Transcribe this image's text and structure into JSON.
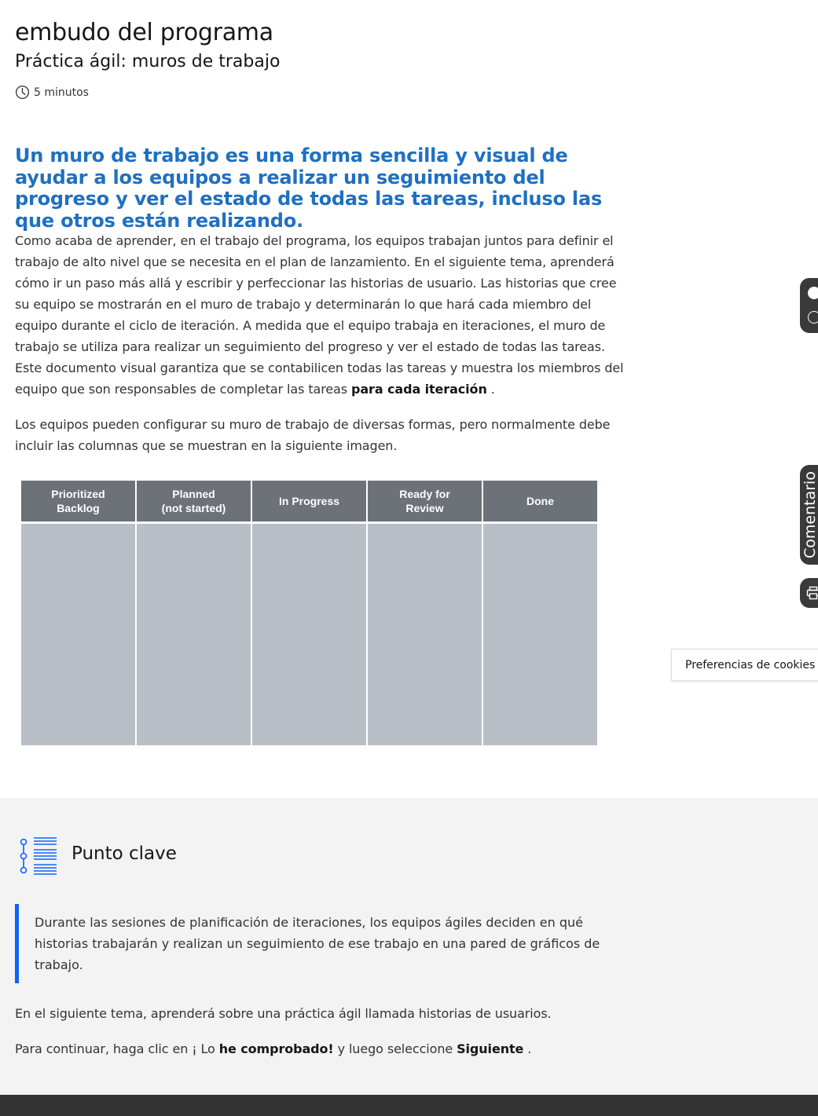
{
  "header": {
    "course_title": "embudo del programa",
    "lesson_title": "Práctica ágil: muros de trabajo",
    "duration": "5 minutos"
  },
  "lead": "Un muro de trabajo es una forma sencilla y visual de ayudar a los equipos a realizar un seguimiento del progreso y ver el estado de todas las tareas, incluso las que otros están realizando.",
  "body": {
    "p1_text": "Como acaba de aprender, en el trabajo del programa, los equipos trabajan juntos para definir el trabajo de alto nivel que se necesita en el plan de lanzamiento. En el siguiente tema, aprenderá cómo ir un paso más allá y escribir y perfeccionar las historias de usuario. Las historias que cree su equipo se mostrarán en el muro de trabajo y determinarán lo que hará cada miembro del equipo durante el ciclo de iteración. A medida que el equipo trabaja en iteraciones, el muro de trabajo se utiliza para realizar un seguimiento del progreso y ver el estado de todas las tareas. Este documento visual garantiza que se contabilicen todas las tareas y muestra los miembros del equipo que son responsables de completar las tareas ",
    "p1_bold": "para cada iteración",
    "p1_end": " .",
    "p2": "Los equipos pueden configurar su muro de trabajo de diversas formas, pero normalmente debe incluir las columnas que se muestran en la siguiente imagen."
  },
  "board": {
    "columns": [
      {
        "line1": "Prioritized",
        "line2": "Backlog"
      },
      {
        "line1": "Planned",
        "line2": "(not started)"
      },
      {
        "line1": "In Progress",
        "line2": ""
      },
      {
        "line1": "Ready for",
        "line2": "Review"
      },
      {
        "line1": "Done",
        "line2": ""
      }
    ],
    "header_color": "#6d7178",
    "body_color": "#b9bfc7"
  },
  "key_point": {
    "title": "Punto clave",
    "quote": "Durante las sesiones de planificación de iteraciones, los equipos ágiles deciden en qué historias trabajarán y realizan un seguimiento de ese trabajo en una pared de gráficos de trabajo.",
    "accent": "#0f62fe"
  },
  "next": {
    "p3": "En el siguiente tema, aprenderá sobre una práctica ágil llamada historias de usuarios.",
    "p4_a": "Para continuar, haga clic en ¡ Lo ",
    "p4_b": "he comprobado!",
    "p4_c": " y luego seleccione  ",
    "p4_d": "Siguiente",
    "p4_e": " ."
  },
  "side": {
    "feedback_label": "Comentario",
    "cookie_label": "Preferencias de cookies"
  },
  "icons": {
    "duration": "clock-icon",
    "key_point": "timeline-list-icon",
    "print": "print-icon"
  },
  "colors": {
    "lead": "#1f70c1",
    "footer": "#333333",
    "key_bg": "#f3f3f3"
  }
}
